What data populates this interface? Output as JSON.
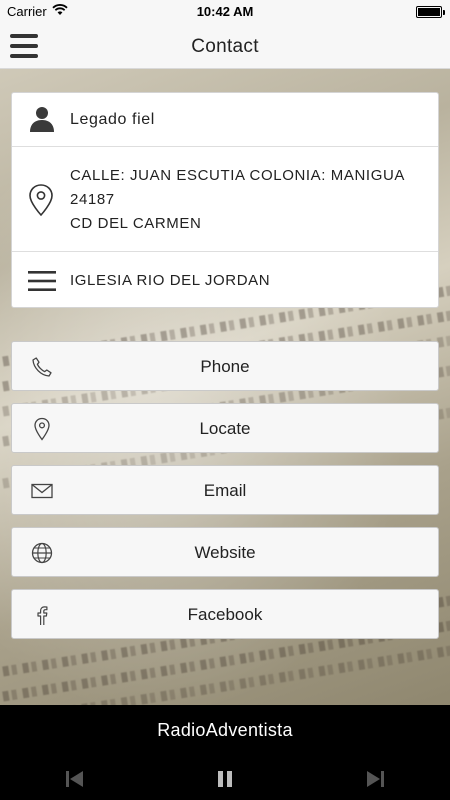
{
  "status_bar": {
    "carrier": "Carrier",
    "time": "10:42 AM"
  },
  "nav": {
    "title": "Contact"
  },
  "contact": {
    "name": "Legado fiel",
    "address_line1": "CALLE: JUAN ESCUTIA COLONIA: MANIGUA 24187",
    "address_line2": "CD DEL CARMEN",
    "church": "IGLESIA RIO DEL JORDAN"
  },
  "actions": [
    {
      "label": "Phone",
      "icon": "phone-icon"
    },
    {
      "label": "Locate",
      "icon": "location-pin-icon"
    },
    {
      "label": "Email",
      "icon": "envelope-icon"
    },
    {
      "label": "Website",
      "icon": "globe-icon"
    },
    {
      "label": "Facebook",
      "icon": "facebook-icon"
    }
  ],
  "player": {
    "station": "RadioAdventista",
    "state": "playing"
  },
  "colors": {
    "nav_bg": "#f7f7f7",
    "player_bg": "#000000",
    "button_bg": "#f7f7f7",
    "control_inactive": "#555555"
  }
}
